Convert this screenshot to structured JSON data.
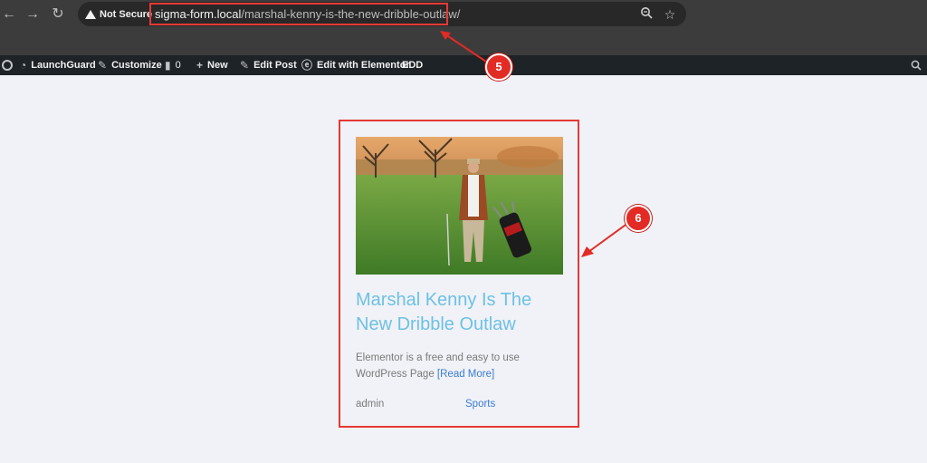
{
  "browser": {
    "security_label": "Not Secure",
    "url_host": "sigma-form.local",
    "url_path": "/marshal-kenny-is-the-new-dribble-outlaw/"
  },
  "admin_bar": {
    "launchguard": "LaunchGuard",
    "customize": "Customize",
    "comments_count": "0",
    "new": "New",
    "edit_post": "Edit Post",
    "edit_elementor": "Edit with Elementor",
    "edd": "EDD"
  },
  "post": {
    "title": "Marshal Kenny Is The New Dribble Outlaw",
    "excerpt": "Elementor is a free and easy to use WordPress Page",
    "read_more": "[Read More]",
    "author": "admin",
    "category": "Sports"
  },
  "callouts": {
    "url_step": "5",
    "card_step": "6"
  },
  "colors": {
    "title": "#6ec1e4",
    "link": "#3a7bd5",
    "highlight": "#e53935"
  }
}
